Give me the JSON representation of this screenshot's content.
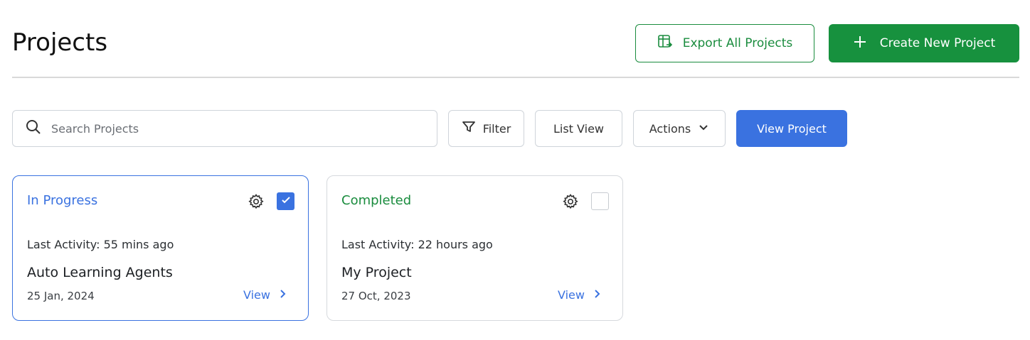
{
  "header": {
    "title": "Projects",
    "export_label": "Export All Projects",
    "create_label": "Create New Project"
  },
  "toolbar": {
    "search_placeholder": "Search Projects",
    "filter_label": "Filter",
    "list_view_label": "List View",
    "actions_label": "Actions",
    "view_project_label": "View Project"
  },
  "colors": {
    "brand_green": "#17913e",
    "accent_blue": "#3a72e0"
  },
  "projects": [
    {
      "status": "In Progress",
      "selected": true,
      "activity": "Last Activity: 55 mins ago",
      "name": "Auto Learning Agents",
      "date": "25 Jan, 2024",
      "view_label": "View"
    },
    {
      "status": "Completed",
      "selected": false,
      "activity": "Last Activity: 22 hours ago",
      "name": "My Project",
      "date": "27 Oct, 2023",
      "view_label": "View"
    }
  ],
  "icons": [
    "export-icon",
    "plus-icon",
    "search-icon",
    "filter-icon",
    "chevron-down-icon",
    "gear-icon",
    "check-icon",
    "chevron-right-icon"
  ]
}
